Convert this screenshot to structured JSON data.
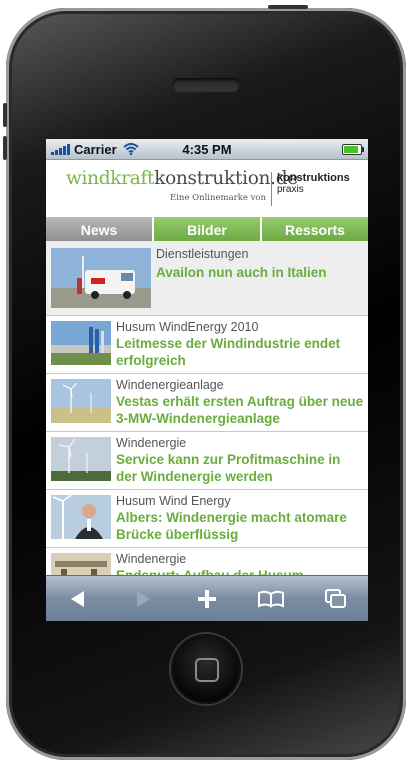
{
  "status": {
    "carrier": "Carrier",
    "time": "4:35 PM",
    "battery": 1.0
  },
  "header": {
    "logo_part1": "windkraft",
    "logo_part2": "konstruktion.de",
    "logo_sub": "Eine Onlinemarke von",
    "partner_line1": "konstruktions",
    "partner_line2": "praxis"
  },
  "tabs": [
    {
      "label": "News",
      "active": true
    },
    {
      "label": "Bilder",
      "active": false
    },
    {
      "label": "Ressorts",
      "active": false
    }
  ],
  "articles": [
    {
      "category": "Dienstleistungen",
      "title": "Availon nun auch in Italien"
    },
    {
      "category": "Husum WindEnergy 2010",
      "title": "Leitmesse der Windindustrie endet erfolgreich"
    },
    {
      "category": "Windenergieanlage",
      "title": "Vestas erhält ersten Auftrag über neue 3-MW-Windenergieanlage"
    },
    {
      "category": "Windenergie",
      "title": "Service kann zur Profitmaschine in der Windenergie werden"
    },
    {
      "category": "Husum Wind Energy",
      "title": "Albers: Windenergie macht atomare Brücke überflüssig"
    },
    {
      "category": "Windenergie",
      "title": "Endspurt: Aufbau der Husum"
    }
  ],
  "toolbar": {
    "icons": [
      "back-icon",
      "forward-icon",
      "add-icon",
      "bookmarks-icon",
      "pages-icon"
    ]
  },
  "colors": {
    "accent_green": "#69ad3c",
    "tab_green": "#7ab648",
    "tab_active": "#a0a0a0"
  }
}
